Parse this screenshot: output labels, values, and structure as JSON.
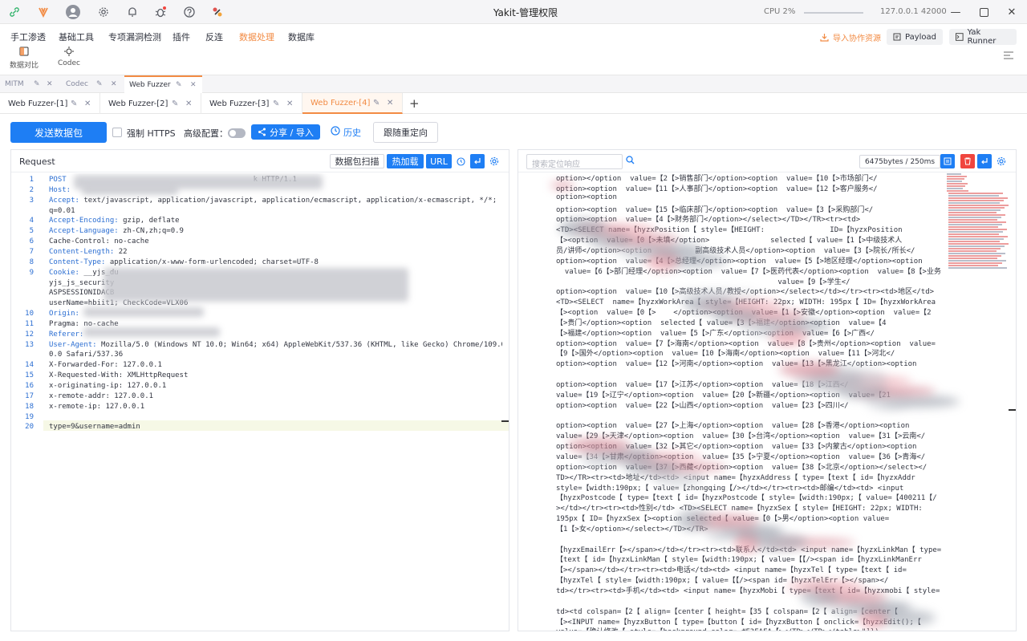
{
  "titlebar": {
    "title": "Yakit-管理权限",
    "cpu": "CPU 2%",
    "host": "127.0.0.1 42000"
  },
  "menu": {
    "items": [
      "手工渗透",
      "基础工具",
      "专项漏洞检测",
      "插件",
      "反连",
      "数据处理",
      "数据库"
    ],
    "active": "数据处理",
    "subitems": [
      "数据对比",
      "Codec"
    ],
    "import_label": "导入协作资源",
    "payload_label": "Payload",
    "runner_label": "Yak Runner"
  },
  "top_tabs": [
    "MITM",
    "Codec",
    "Web Fuzzer"
  ],
  "fuzzer_tabs": [
    "Web Fuzzer-[1]",
    "Web Fuzzer-[2]",
    "Web Fuzzer-[3]",
    "Web Fuzzer-[4]"
  ],
  "toolbar": {
    "send": "发送数据包",
    "force_https": "强制 HTTPS",
    "advanced": "高级配置：",
    "share": "分享 / 导入",
    "history": "历史",
    "redirect": "跟随重定向"
  },
  "request": {
    "title": "Request",
    "scan": "数据包扫描",
    "hotload": "热加载",
    "url": "URL",
    "lines": [
      {
        "n": "1",
        "key": "POST",
        "val": "                                           k HTTP/1.1"
      },
      {
        "n": "2",
        "key": "Host:",
        "val": ""
      },
      {
        "n": "3",
        "key": "Accept:",
        "val": " text/javascript, application/javascript, application/ecmascript, application/x-ecmascript, */*;"
      },
      {
        "n": "",
        "key": "",
        "val": "q=0.01"
      },
      {
        "n": "4",
        "key": "Accept-Encoding:",
        "val": " gzip, deflate"
      },
      {
        "n": "5",
        "key": "Accept-Language:",
        "val": " zh-CN,zh;q=0.9"
      },
      {
        "n": "6",
        "key": "",
        "val": "Cache-Control: no-cache"
      },
      {
        "n": "7",
        "key": "Content-Length:",
        "val": " 22"
      },
      {
        "n": "8",
        "key": "Content-Type:",
        "val": " application/x-www-form-urlencoded; charset=UTF-8"
      },
      {
        "n": "9",
        "key": "Cookie:",
        "val": " __yjs_du"
      },
      {
        "n": "",
        "key": "",
        "val": "yjs_js_security"
      },
      {
        "n": "",
        "key": "",
        "val": "ASPSESSIONIDACB"
      },
      {
        "n": "",
        "key": "",
        "val": "userName=hbiit1; CheckCode=VLX06"
      },
      {
        "n": "10",
        "key": "Origin:",
        "val": ""
      },
      {
        "n": "11",
        "key": "",
        "val": "Pragma: no-cache"
      },
      {
        "n": "12",
        "key": "Referer:",
        "val": ""
      },
      {
        "n": "13",
        "key": "User-Agent:",
        "val": " Mozilla/5.0 (Windows NT 10.0; Win64; x64) AppleWebKit/537.36 (KHTML, like Gecko) Chrome/109.0."
      },
      {
        "n": "",
        "key": "",
        "val": "0.0 Safari/537.36"
      },
      {
        "n": "14",
        "key": "",
        "val": "X-Forwarded-For: 127.0.0.1"
      },
      {
        "n": "15",
        "key": "",
        "val": "X-Requested-With: XMLHttpRequest"
      },
      {
        "n": "16",
        "key": "",
        "val": "x-originating-ip: 127.0.0.1"
      },
      {
        "n": "17",
        "key": "",
        "val": "x-remote-addr: 127.0.0.1"
      },
      {
        "n": "18",
        "key": "",
        "val": "x-remote-ip: 127.0.0.1"
      },
      {
        "n": "19",
        "key": "",
        "val": ""
      },
      {
        "n": "20",
        "key": "",
        "val": "type=9&username=admin"
      }
    ]
  },
  "response": {
    "search_placeholder": "搜索定位响应",
    "size": "6475bytes / 250ms",
    "lines": [
      "option></option  value=【2【>销售部门</option><option  value=【10【>市场部门</",
      "option><option  value=【11【>人事部门</option><option  value=【12【>客户服务</",
      "option><option                                                                 ",
      "option><option  value=【15【>临床部门</option><option  value=【3【>采购部门</",
      "option><option  value=【4【>财务部门</option></select></TD></TR><tr><td>",
      "<TD><SELECT name=【hyzxPosition【 style=【HEIGHT:               ID=【hyzxPosition",
      "【><option  value=【0【>未填</option>              selected【 value=【1【>中级技术人",
      "员/讲师</option><option          副高级技术人员</option><option  value=【3【>院长/所长</",
      "option><option  value=【4【>总经理</option><option  value=【5【>地区经理</option><option",
      "  value=【6【>部门经理</option><option  value=【7【>医药代表</option><option  value=【8【>业务",
      "                                                   value=【9【>学生</",
      "option><option  value=【10【>高级技术人员/教授</option></select></td></tr><tr><td>地区</td>",
      "<TD><SELECT  name=【hyzxWorkArea【 style=【HEIGHT: 22px; WIDTH: 195px【 ID=【hyzxWorkArea",
      "【><option  value=【0【>    </option><option  value=【1【>安徽</option><option  value=【2",
      "【>贵门</option><option  selected【 value=【3【>福建</option><option  value=【4",
      "【>福建</option><option  value=【5【>广东</option><option  value=【6【>广西</",
      "option><option  value=【7【>海南</option><option  value=【8【>贵州</option><option  value=",
      "【9【>国外</option><option  value=【10【>海南</option><option  value=【11【>河北</",
      "option><option  value=【12【>河南</option><option  value=【13【>黑龙江</option><option",
      "                                                                   ",
      "option><option  value=【17【>江苏</option><option  value=【18【>江西</",
      "value=【19【>辽宁</option><option  value=【20【>新疆</option><option  value=【21",
      "option><option  value=【22【>山西</option><option  value=【23【>四川</",
      "                                                                    ",
      "option><option  value=【27【>上海</option><option  value=【28【>香港</option><option",
      "value=【29【>天津</option><option  value=【30【>台湾</option><option  value=【31【>云南</",
      "option><option  value=【32【>其它</option><option  value=【33【>内蒙古</option><option",
      "value=【34【>甘肃</option><option  value=【35【>宁夏</option><option  value=【36【>青海</",
      "option><option  value=【37【>西藏</option><option  value=【38【>北京</option></select></",
      "TD></TR><tr><td>地址</td><td> <input name=【hyzxAddress【 type=【text【 id=【hyzxAddr",
      "style=【width:190px;【 value=【zhongqing【/></td></tr><tr><td>邮编</td><td> <input",
      "【hyzxPostcode【 type=【text【 id=【hyzxPostcode【 style=【width:190px;【 value=【400211【/",
      "></td></tr><tr><td>性别</td> <TD><SELECT name=【hyzxSex【 style=【HEIGHT: 22px; WIDTH:",
      "195px【 ID=【hyzxSex【><option selected【 value=【0【>男</option><option value=",
      "【1【>女</option></select></TD></TR>",
      "                                                                    ",
      "【hyzxEmailErr【></span></td></tr><tr><td>联系人</td><td> <input name=【hyzxLinkMan【 type=",
      "【text【 id=【hyzxLinkMan【 style=【width:190px;【 value=【【/><span id=【hyzxLinkManErr",
      "【></span></td></tr><tr><td>电话</td><td> <input name=【hyzxTel【 type=【text【 id=",
      "【hyzxTel【 style=【width:190px;【 value=【【/><span id=【hyzxTelErr【></span></",
      "td></tr><tr><td>手机</td><td> <input name=【hyzxMobi【 type=【text【 id=【hyzxmobi【 style=",
      "                                                                   ",
      "td><td colspan=【2【 align=【center【 height=【35【 colspan=【2【 align=【center【",
      "【><INPUT name=【hyzxButton【 type=【button【 id=【hyzxButton【 onclick=【hyzxEdit();【",
      "value=【确认修改【 style=【background-color= #F3FAFA【></TD></TR></table>\"]})"
    ]
  },
  "colors": {
    "accent": "#f28b44",
    "primary": "#1e7ef4",
    "danger": "#f0453e"
  }
}
